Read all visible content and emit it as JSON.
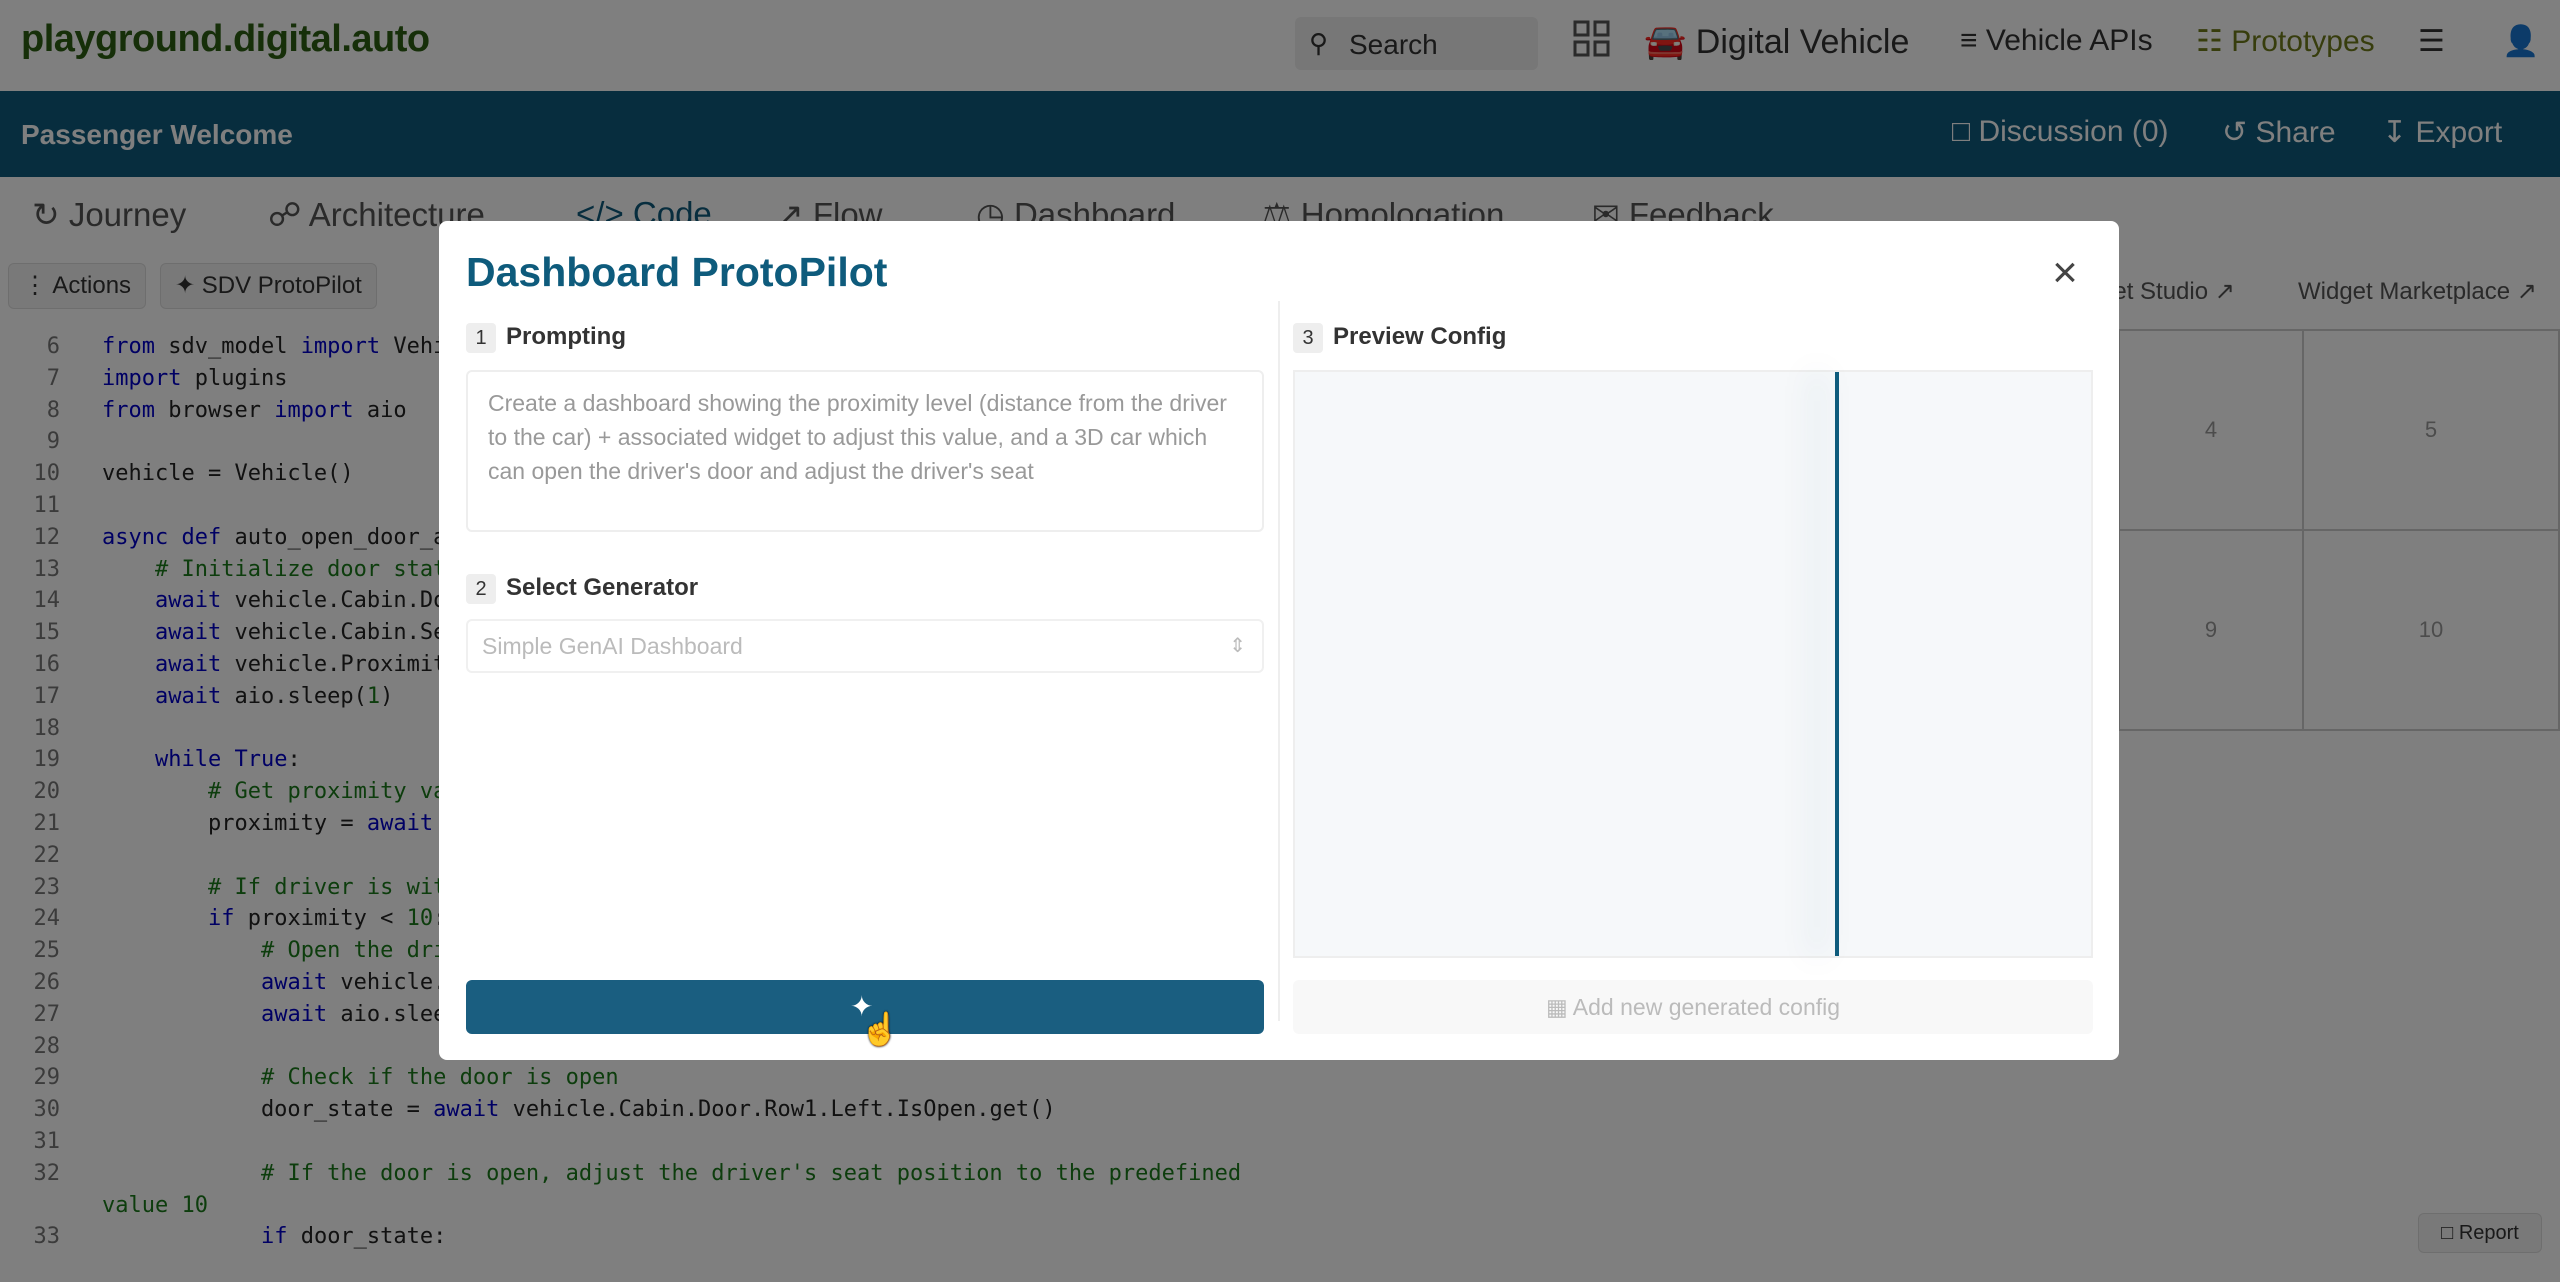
{
  "topbar": {
    "logo": "playground.digital.auto",
    "search_placeholder": "Search",
    "digital_vehicle": "Digital Vehicle",
    "vehicle_apis": "Vehicle APIs",
    "prototypes": "Prototypes"
  },
  "band": {
    "title": "Passenger Welcome",
    "discussion": "Discussion (0)",
    "share": "Share",
    "export": "Export"
  },
  "tabs": [
    "Journey",
    "Architecture",
    "Code",
    "Flow",
    "Dashboard",
    "Homologation",
    "Feedback"
  ],
  "toolbar": {
    "actions": "Actions",
    "protopilot": "SDV ProtoPilot",
    "widget_studio": "get Studio",
    "widget_marketplace": "Widget Marketplace"
  },
  "code_lines": [
    {
      "n": "6",
      "html": "<span class='kw'>from</span> sdv_model <span class='kw'>import</span> Vehi"
    },
    {
      "n": "7",
      "html": "<span class='kw'>import</span> plugins"
    },
    {
      "n": "8",
      "html": "<span class='kw'>from</span> browser <span class='kw'>import</span> aio"
    },
    {
      "n": "9",
      "html": ""
    },
    {
      "n": "10",
      "html": "vehicle = Vehicle()"
    },
    {
      "n": "11",
      "html": ""
    },
    {
      "n": "12",
      "html": "<span class='kw'>async</span> <span class='kw'>def</span> auto_open_door_a"
    },
    {
      "n": "13",
      "html": "    <span class='cm'># Initialize door stat</span>"
    },
    {
      "n": "14",
      "html": "    <span class='kw'>await</span> vehicle.Cabin.Do"
    },
    {
      "n": "15",
      "html": "    <span class='kw'>await</span> vehicle.Cabin.Se"
    },
    {
      "n": "16",
      "html": "    <span class='kw'>await</span> vehicle.Proximit"
    },
    {
      "n": "17",
      "html": "    <span class='kw'>await</span> aio.sleep(<span class='nm'>1</span>)"
    },
    {
      "n": "18",
      "html": ""
    },
    {
      "n": "19",
      "html": "    <span class='kw'>while</span> <span class='kw'>True</span>:"
    },
    {
      "n": "20",
      "html": "        <span class='cm'># Get proximity va</span>"
    },
    {
      "n": "21",
      "html": "        proximity = <span class='kw'>await</span>"
    },
    {
      "n": "22",
      "html": ""
    },
    {
      "n": "23",
      "html": "        <span class='cm'># If driver is wit</span>"
    },
    {
      "n": "24",
      "html": "        <span class='kw'>if</span> proximity &lt; <span class='nm'>10</span>:"
    },
    {
      "n": "25",
      "html": "            <span class='cm'># Open the dri</span>"
    },
    {
      "n": "26",
      "html": "            <span class='kw'>await</span> vehicle."
    },
    {
      "n": "27",
      "html": "            <span class='kw'>await</span> aio.slee"
    },
    {
      "n": "28",
      "html": ""
    },
    {
      "n": "29",
      "html": "            <span class='cm'># Check if the door is open</span>"
    },
    {
      "n": "30",
      "html": "            door_state = <span class='kw'>await</span> vehicle.Cabin.Door.Row1.Left.IsOpen.get()"
    },
    {
      "n": "31",
      "html": ""
    },
    {
      "n": "32",
      "html": "            <span class='cm'># If the door is open, adjust the driver's seat position to the predefined</span>"
    },
    {
      "n": "",
      "html": "<span class='cm'>value 10</span>"
    },
    {
      "n": "33",
      "html": "            <span class='kw'>if</span> door_state:"
    }
  ],
  "grid_labels": [
    "4",
    "5",
    "9",
    "10"
  ],
  "report": "Report",
  "modal": {
    "title": "Dashboard ProtoPilot",
    "step1_num": "1",
    "step1_label": "Prompting",
    "prompt_text": "Create a dashboard showing the proximity level (distance from the driver to the car) + associated widget to adjust this value, and a 3D car which can open the driver's door and adjust the driver's seat",
    "step2_num": "2",
    "step2_label": "Select Generator",
    "generator_value": "Simple GenAI Dashboard",
    "step3_num": "3",
    "step3_label": "Preview Config",
    "add_config": "Add new generated config"
  }
}
